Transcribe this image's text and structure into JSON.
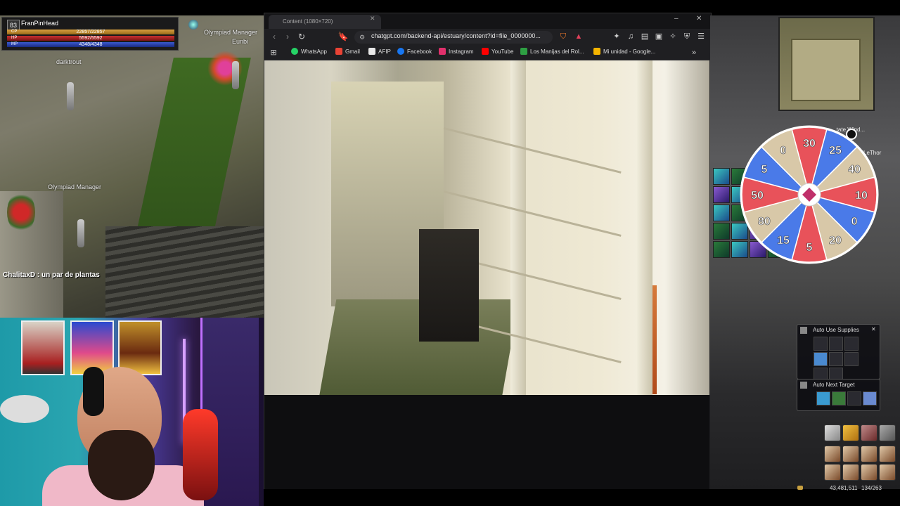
{
  "game_left": {
    "character": {
      "level": "83",
      "name": "FranPinHead",
      "cp_label": "CP",
      "cp_value": "22857/22857",
      "hp_label": "HP",
      "hp_value": "5592/5592",
      "mp_label": "MP",
      "mp_value": "4348/4348"
    },
    "npc_labels": {
      "olympiad_manager_top": "Olympiad Manager",
      "eunbi": "Eunbi",
      "darktrout": "darktrout",
      "olympiad_manager_mid": "Olympiad Manager"
    },
    "chat_line": "ChalitaxD : un par de plantas"
  },
  "browser": {
    "tab_title": "Content (1080×720)",
    "url": "chatgpt.com/backend-api/estuary/content?id=file_0000000...",
    "bookmarks": [
      {
        "label": "WhatsApp",
        "color": "#25d366"
      },
      {
        "label": "Gmail",
        "color": "#ea4335"
      },
      {
        "label": "AFIP",
        "color": "#e8e8e8"
      },
      {
        "label": "Facebook",
        "color": "#1877f2"
      },
      {
        "label": "Instagram",
        "color": "#e1306c"
      },
      {
        "label": "YouTube",
        "color": "#ff0000"
      },
      {
        "label": "Los Manijas del Rol...",
        "color": "#2ea043"
      },
      {
        "label": "Mi unidad - Google...",
        "color": "#f4b400"
      }
    ],
    "more_bookmarks_icon": "chevron-double-right-icon"
  },
  "game_right": {
    "wheel": {
      "segments": [
        "30",
        "25",
        "40",
        "10",
        "0",
        "20",
        "5",
        "15",
        "80",
        "50",
        "5",
        "0"
      ],
      "colors": {
        "red": "#e8525a",
        "blue": "#4a7ae8",
        "beige": "#d8c8a8"
      }
    },
    "target_label": "...tate Wind...",
    "player_suffix": "LeThor",
    "auto_use_supplies": "Auto Use Supplies",
    "auto_next_target": "Auto Next Target",
    "status_numbers": "43,481,511",
    "weight": "134/263"
  }
}
